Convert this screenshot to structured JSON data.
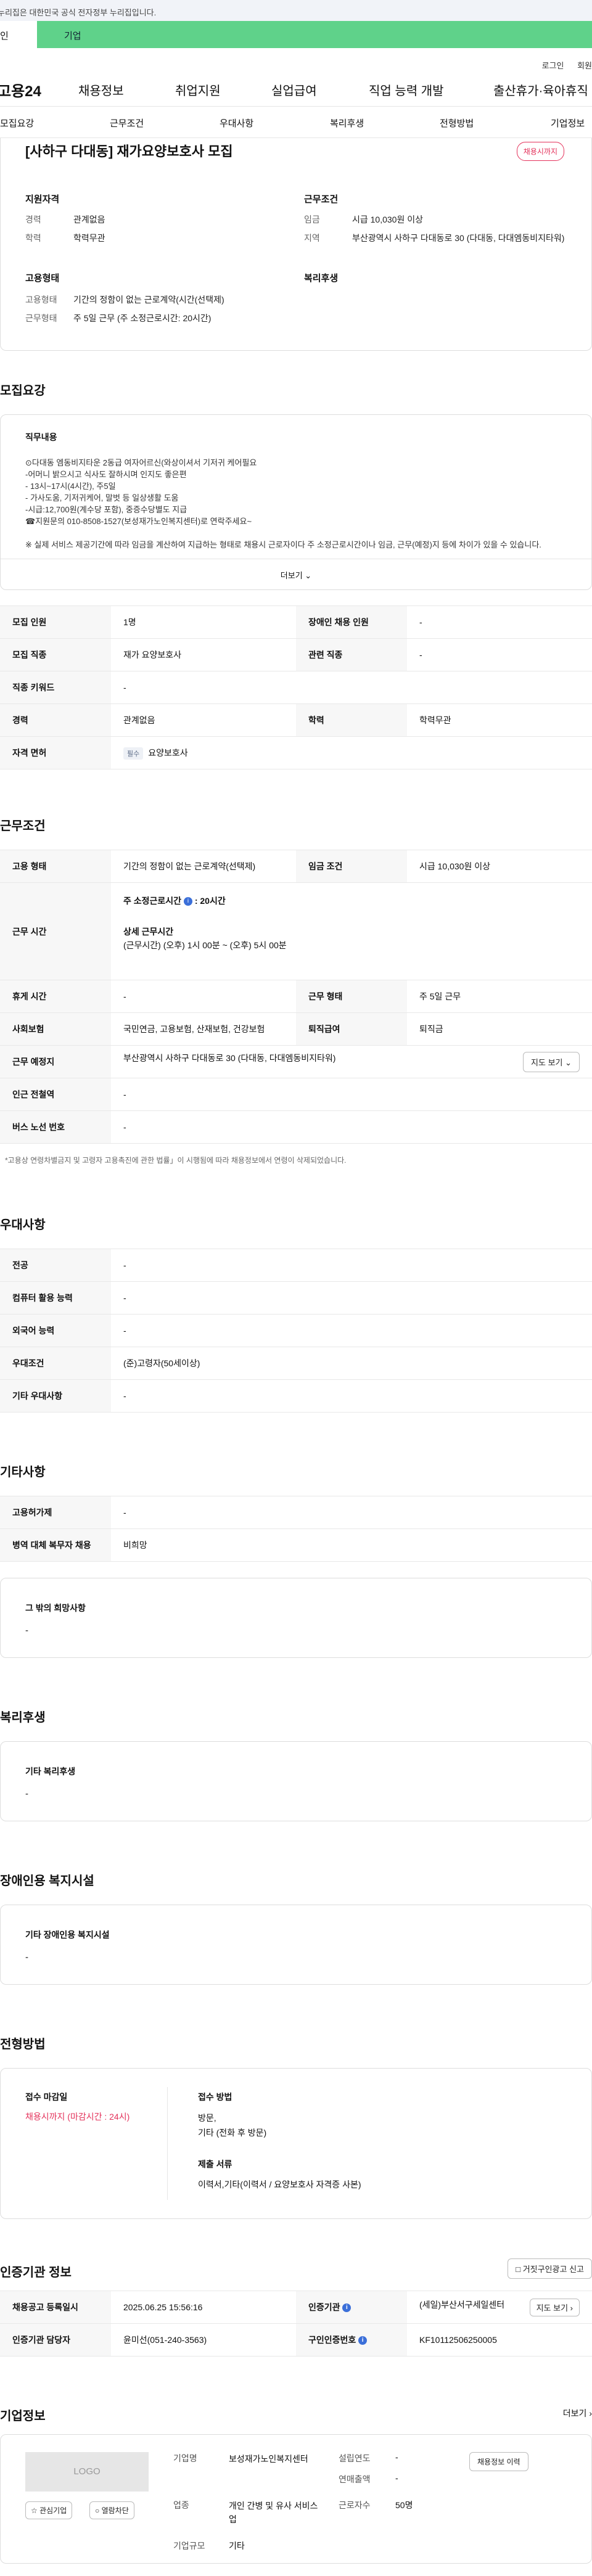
{
  "gov_strip": "누리집은 대한민국 공식 전자정부 누리집입니다.",
  "top_tabs": [
    "인",
    "기업"
  ],
  "util_links": [
    "로그인",
    "회원"
  ],
  "gnb": {
    "logo": "고용24",
    "items": [
      "채용정보",
      "취업지원",
      "실업급여",
      "직업 능력 개발",
      "출산휴가·육아휴직"
    ]
  },
  "subnav": [
    "모집요강",
    "근무조건",
    "우대사항",
    "복리후생",
    "전형방법",
    "기업정보"
  ],
  "job": {
    "title": "[사하구 다대동] 재가요양보호사 모집",
    "deadline_badge": "채용시까지",
    "qual_title": "지원자격",
    "cond_title": "근무조건",
    "emp_title": "고용형태",
    "welfare_title": "복리후생",
    "qual": [
      {
        "k": "경력",
        "v": "관계없음"
      },
      {
        "k": "학력",
        "v": "학력무관"
      }
    ],
    "cond": [
      {
        "k": "임금",
        "v": "시급 10,030원 이상"
      },
      {
        "k": "지역",
        "v": "부산광역시 사하구 다대동로 30 (다대동, 다대엠동비지타워)"
      }
    ],
    "emp": [
      {
        "k": "고용형태",
        "v": "기간의 정함이 없는 근로계약(시간(선택제)"
      },
      {
        "k": "근무형태",
        "v": "주 5일 근무 (주 소정근로시간: 20시간)"
      }
    ]
  },
  "recruit": {
    "title": "모집요강",
    "duty_title": "직무내용",
    "duty_lines": [
      "⊙다대동 엠동비지타운 2동급 여자어르신(와상이셔서 기저귀 케어필요",
      "-어머니 밝으시고 식사도 잘하시며 인지도 좋은편",
      "- 13시~17시(4시간), 주5일",
      "- 가사도움, 기저귀케어, 말벗 등 일상생활 도움",
      "-시급:12,700원(계수당 포함), 중증수당별도 지급",
      "☎지원문의 010-8508-1527(보성재가노인복지센터)로 연락주세요~",
      "",
      "※ 실제 서비스 제공기간에 따라 임금을 계산하여 지급하는 형태로 채용시 근로자이다 주 소정근로시간이나 임금, 근무(예정)지 등에 차이가 있을 수 있습니다."
    ],
    "more": "더보기",
    "rows": [
      [
        {
          "h": "모집 인원",
          "v": "1명"
        },
        {
          "h": "장애인 채용 인원",
          "v": "-"
        }
      ],
      [
        {
          "h": "모집 직종",
          "v": "재가 요양보호사"
        },
        {
          "h": "관련 직종",
          "v": "-"
        }
      ],
      [
        {
          "h": "직종 키워드",
          "v": "-"
        }
      ],
      [
        {
          "h": "경력",
          "v": "관계없음"
        },
        {
          "h": "학력",
          "v": "학력무관"
        }
      ]
    ],
    "license_h": "자격 면허",
    "license_tag": "필수",
    "license_v": "요양보호사"
  },
  "work": {
    "title": "근무조건",
    "emp_h": "고용 형태",
    "emp_v": "기간의 정함이 없는 근로계약(선택제)",
    "wage_h": "임금 조건",
    "wage_v": "시급 10,030원 이상",
    "time_h": "근무 시간",
    "time_main": "주 소정근로시간",
    "time_main_v": ": 20시간",
    "time_detail_t": "상세 근무시간",
    "time_detail_v": "(근무시간) (오후) 1시 00분 ~ (오후) 5시 00분",
    "rest_h": "휴게 시간",
    "rest_v": "-",
    "form_h": "근무 형태",
    "form_v": "주 5일 근무",
    "ins_h": "사회보험",
    "ins_v": "국민연금, 고용보험, 산재보험, 건강보험",
    "ret_h": "퇴직급여",
    "ret_v": "퇴직금",
    "place_h": "근무 예정지",
    "place_v": "부산광역시 사하구 다대동로 30 (다대동, 다대엠동비지타워)",
    "map_btn": "지도 보기",
    "station_h": "인근 전철역",
    "station_v": "-",
    "bus_h": "버스 노선 번호",
    "bus_v": "-",
    "note": "*고용상 연령차별금지 및 고령자 고용촉진에 관한 법률」이 시행됨에 따라 채용정보에서 연령이 삭제되었습니다."
  },
  "pref": {
    "title": "우대사항",
    "rows": [
      {
        "h": "전공",
        "v": "-"
      },
      {
        "h": "컴퓨터 활용 능력",
        "v": "-"
      },
      {
        "h": "외국어 능력",
        "v": "-"
      },
      {
        "h": "우대조건",
        "v": "(준)고령자(50세이상)"
      },
      {
        "h": "기타 우대사항",
        "v": "-"
      }
    ]
  },
  "etc": {
    "title": "기타사항",
    "rows": [
      {
        "h": "고용허가제",
        "v": "-"
      },
      {
        "h": "병역 대체 복무자 채용",
        "v": "비희망"
      }
    ],
    "hope_t": "그 밖의 희망사항",
    "hope_v": "-"
  },
  "welfare": {
    "title": "복리후생",
    "box_t": "기타 복리후생",
    "box_v": "-"
  },
  "disabled": {
    "title": "장애인용 복지시설",
    "box_t": "기타 장애인용 복지시설",
    "box_v": "-"
  },
  "selection": {
    "title": "전형방법",
    "deadline_t": "접수 마감일",
    "deadline_v": "채용시까지 (마감시간 : 24시)",
    "method_t": "접수 방법",
    "method_v1": "방문,",
    "method_v2": "기타 (전화 후 방문)",
    "docs_t": "제출 서류",
    "docs_v": "이력서,기타(이력서 / 요양보호사 자격증 사본)"
  },
  "agency": {
    "title": "인증기관 정보",
    "report_btn": "거짓구인광고 신고",
    "reg_h": "채용공고 등록일시",
    "reg_v": "2025.06.25 15:56:16",
    "org_h": "인증기관",
    "org_v": "(세일)부산서구세일센터",
    "map_btn": "지도 보기",
    "mgr_h": "인증기관 담당자",
    "mgr_v": "윤미선(051-240-3563)",
    "num_h": "구인인증번호",
    "num_v": "KF10112506250005"
  },
  "company": {
    "title": "기업정보",
    "more": "더보기",
    "logo_ph": "LOGO",
    "fav_btn": "관심기업",
    "block_btn": "열람차단",
    "name_h": "기업명",
    "name_v": "보성재가노인복지센터",
    "year_h": "설립연도",
    "year_v": "-",
    "sales_h": "연매출액",
    "sales_v": "-",
    "biz_h": "업종",
    "biz_v": "개인 간병 및 유사 서비스업",
    "emp_h": "근로자수",
    "emp_v": "50명",
    "size_h": "기업규모",
    "size_v": "기타",
    "info_btn": "채용정보 이력"
  }
}
